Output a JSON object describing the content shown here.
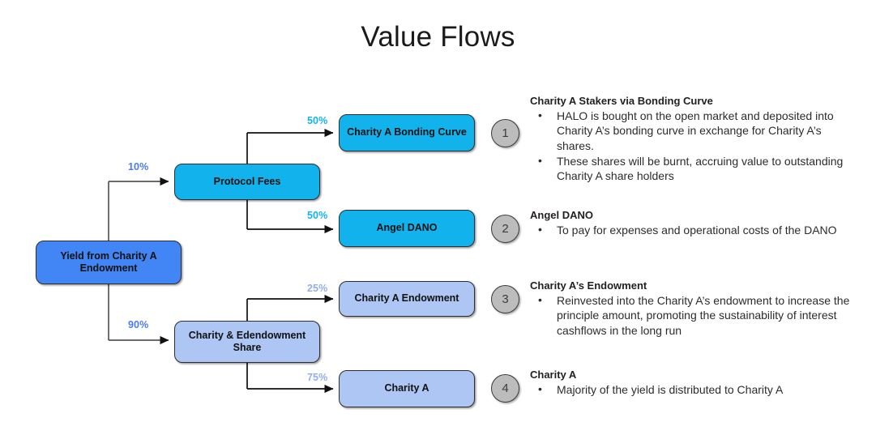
{
  "title": "Value Flows",
  "nodes": {
    "yield": {
      "label": "Yield from Charity A Endowment",
      "color": "#4285f4"
    },
    "protocol_fees": {
      "label": "Protocol Fees",
      "color": "#12b3ec"
    },
    "charity_endowment_share": {
      "label": "Charity & Edendowment Share",
      "color": "#adc6f4"
    },
    "bonding_curve": {
      "label": "Charity A Bonding Curve",
      "color": "#12b3ec"
    },
    "angel_dano": {
      "label": "Angel DANO",
      "color": "#12b3ec"
    },
    "charity_a_endowment": {
      "label": "Charity A Endowment",
      "color": "#adc6f4"
    },
    "charity_a": {
      "label": "Charity A",
      "color": "#adc6f4"
    }
  },
  "edges": {
    "yield_to_fees": {
      "label": "10%",
      "color": "#4a7bf0"
    },
    "yield_to_share": {
      "label": "90%",
      "color": "#4a7bf0"
    },
    "fees_to_bonding": {
      "label": "50%",
      "color": "#12b3ec"
    },
    "fees_to_angel": {
      "label": "50%",
      "color": "#12b3ec"
    },
    "share_to_endowment": {
      "label": "25%",
      "color": "#8fafe8"
    },
    "share_to_charity": {
      "label": "75%",
      "color": "#8fafe8"
    }
  },
  "badges": {
    "one": "1",
    "two": "2",
    "three": "3",
    "four": "4"
  },
  "notes": [
    {
      "heading": "Charity A Stakers via Bonding Curve",
      "bullets": [
        "HALO is bought on the open market and deposited into Charity A’s bonding curve in exchange for Charity A’s shares.",
        "These shares will be burnt, accruing value to outstanding Charity A share holders"
      ]
    },
    {
      "heading": "Angel DANO",
      "bullets": [
        "To pay for expenses and operational costs of the DANO"
      ]
    },
    {
      "heading": "Charity A’s Endowment",
      "bullets": [
        "Reinvested into the Charity A’s endowment to increase the principle amount, promoting the sustainability of interest cashflows  in the long run"
      ]
    },
    {
      "heading": "Charity A",
      "bullets": [
        "Majority of the yield is distributed to Charity A"
      ]
    }
  ],
  "bullet_glyph": "•"
}
